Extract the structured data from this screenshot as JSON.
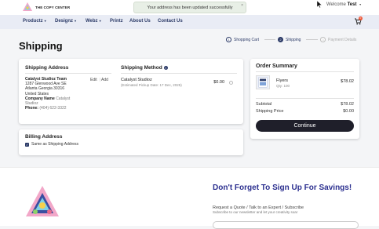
{
  "brand": {
    "name": "THE COPY CENTER"
  },
  "toast": {
    "message": "Your address has been updated successfully"
  },
  "user": {
    "greeting": "Welcome",
    "name": "Test"
  },
  "cart": {
    "count": "0"
  },
  "nav": {
    "items": [
      {
        "label": "Productz",
        "has_menu": true
      },
      {
        "label": "Designz",
        "has_menu": true
      },
      {
        "label": "Webz",
        "has_menu": true
      },
      {
        "label": "Printz",
        "has_menu": false
      },
      {
        "label": "About Us",
        "has_menu": false
      },
      {
        "label": "Contact Us",
        "has_menu": false
      }
    ]
  },
  "page": {
    "title": "Shipping"
  },
  "steps": [
    {
      "num": "1",
      "label": "Shopping Cart",
      "state": "done"
    },
    {
      "num": "2",
      "label": "Shipping",
      "state": "active"
    },
    {
      "num": "3",
      "label": "Payment Details",
      "state": "todo"
    }
  ],
  "shipping_address": {
    "title": "Shipping Address",
    "edit_label": "Edit",
    "add_label": "Add",
    "name": "Catalyst Studioz Team",
    "street": "1287 Glenwood Ave SE",
    "city_line": "Atlanta Georgia 30316",
    "country": "United States",
    "company_label": "Company Name",
    "company_value": "Catalyst",
    "company_value2": "Studioz",
    "phone_label": "Phone",
    "phone_value": "(404) 622-3322"
  },
  "shipping_method": {
    "title": "Shipping Method",
    "name": "Catalyst Studioz",
    "pickup": "(Estimated Pickup Date: 17 Dec, 2025)",
    "price": "$0.00"
  },
  "billing": {
    "title": "Billing Address",
    "checkbox_label": "Same as Shipping Address",
    "checked": true
  },
  "summary": {
    "title": "Order Summary",
    "item_name": "Flyers",
    "item_qty": "Qty: 100",
    "item_price": "$78.02",
    "subtotal_label": "Subtotal",
    "subtotal_value": "$78.02",
    "shipping_label": "Shipping Price",
    "shipping_value": "$0.00",
    "continue_label": "Continue"
  },
  "footer": {
    "promo_title": "Don't Forget To Sign Up For Savings!",
    "promo_sub": "Request a Quote / Talk to an Expert / Subscribe",
    "promo_sub2": "Subscribe to our newsletter and let your creativity soar"
  },
  "colors": {
    "brand_navy": "#2b3a67",
    "promo_blue": "#2b2f8f",
    "button_dark": "#1f1f2a"
  }
}
